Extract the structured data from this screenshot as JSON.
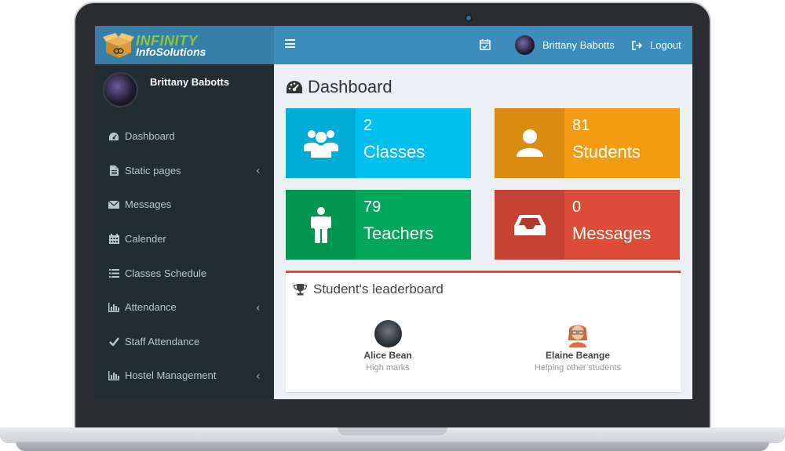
{
  "brand": {
    "line1": "INFINITY",
    "line2": "InfoSolutions"
  },
  "sidebar": {
    "user_name": "Brittany Babotts",
    "items": [
      {
        "label": "Dashboard",
        "icon": "dashboard-icon",
        "has_submenu": false
      },
      {
        "label": "Static pages",
        "icon": "file-icon",
        "has_submenu": true
      },
      {
        "label": "Messages",
        "icon": "envelope-icon",
        "has_submenu": false
      },
      {
        "label": "Calender",
        "icon": "calendar-icon",
        "has_submenu": false
      },
      {
        "label": "Classes Schedule",
        "icon": "list-icon",
        "has_submenu": false
      },
      {
        "label": "Attendance",
        "icon": "bar-chart-icon",
        "has_submenu": true
      },
      {
        "label": "Staff Attendance",
        "icon": "check-icon",
        "has_submenu": false
      },
      {
        "label": "Hostel Management",
        "icon": "bar-chart-icon",
        "has_submenu": true
      }
    ]
  },
  "header": {
    "user_name": "Brittany Babotts",
    "logout_label": "Logout"
  },
  "main": {
    "title": "Dashboard",
    "stats": [
      {
        "value": "2",
        "label": "Classes",
        "color": "#00c0ef",
        "icon": "users-icon"
      },
      {
        "value": "81",
        "label": "Students",
        "color": "#f39c12",
        "icon": "user-icon"
      },
      {
        "value": "79",
        "label": "Teachers",
        "color": "#00a65a",
        "icon": "male-icon"
      },
      {
        "value": "0",
        "label": "Messages",
        "color": "#dd4b39",
        "icon": "inbox-icon"
      }
    ],
    "leaderboard": {
      "title": "Student's leaderboard",
      "users": [
        {
          "name": "Alice Bean",
          "description": "High marks"
        },
        {
          "name": "Elaine Beange",
          "description": "Helping other students"
        }
      ]
    }
  },
  "colors": {
    "header": "#3c8dbc",
    "logo_bar": "#367fa9",
    "sidebar": "#222d32",
    "content_bg": "#ecf0f5"
  }
}
